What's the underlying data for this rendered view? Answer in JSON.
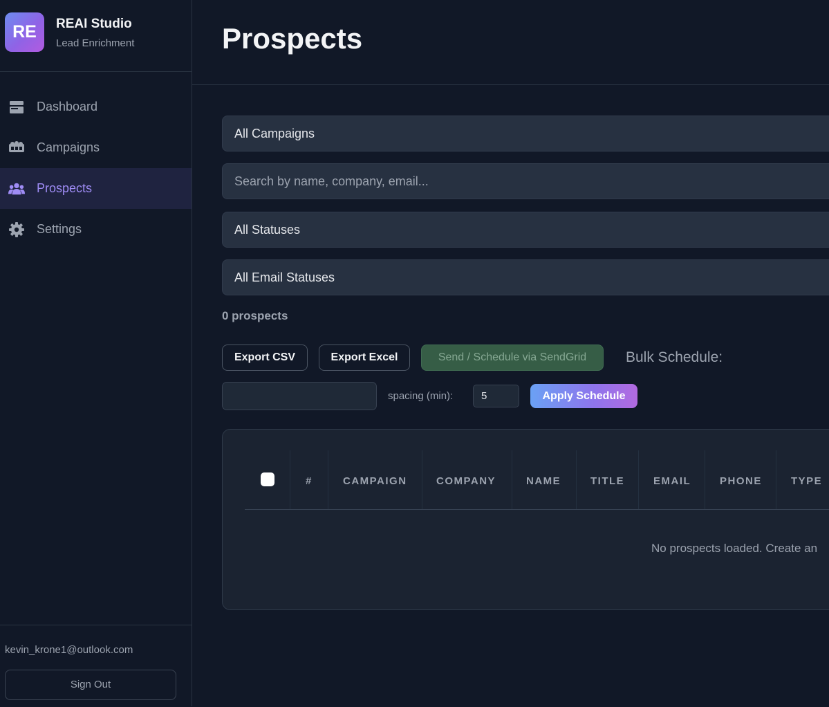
{
  "brand": {
    "logo_text": "RE",
    "title": "REAI Studio",
    "subtitle": "Lead Enrichment"
  },
  "nav": [
    {
      "label": "Dashboard",
      "icon": "dashboard-icon",
      "active": false
    },
    {
      "label": "Campaigns",
      "icon": "campaigns-icon",
      "active": false
    },
    {
      "label": "Prospects",
      "icon": "users-icon",
      "active": true
    },
    {
      "label": "Settings",
      "icon": "gear-icon",
      "active": false
    }
  ],
  "user": {
    "email": "kevin_krone1@outlook.com",
    "signout_label": "Sign Out"
  },
  "page": {
    "title": "Prospects"
  },
  "filters": {
    "campaign": "All Campaigns",
    "search_placeholder": "Search by name, company, email...",
    "status": "All Statuses",
    "email_status": "All Email Statuses"
  },
  "count_text": "0 prospects",
  "actions": {
    "export_csv": "Export CSV",
    "export_excel": "Export Excel",
    "send_schedule": "Send / Schedule via SendGrid",
    "bulk_schedule_label": "Bulk Schedule:",
    "spacing_label": "spacing (min):",
    "spacing_value": "5",
    "apply_schedule": "Apply Schedule"
  },
  "table": {
    "columns": [
      "#",
      "CAMPAIGN",
      "COMPANY",
      "NAME",
      "TITLE",
      "EMAIL",
      "PHONE",
      "TYPE"
    ],
    "empty_message": "No prospects loaded. Create an"
  },
  "colors": {
    "background": "#111827",
    "accent": "#9f8cf5",
    "active_nav_bg": "#1f2340",
    "send_button": "#365d46"
  }
}
